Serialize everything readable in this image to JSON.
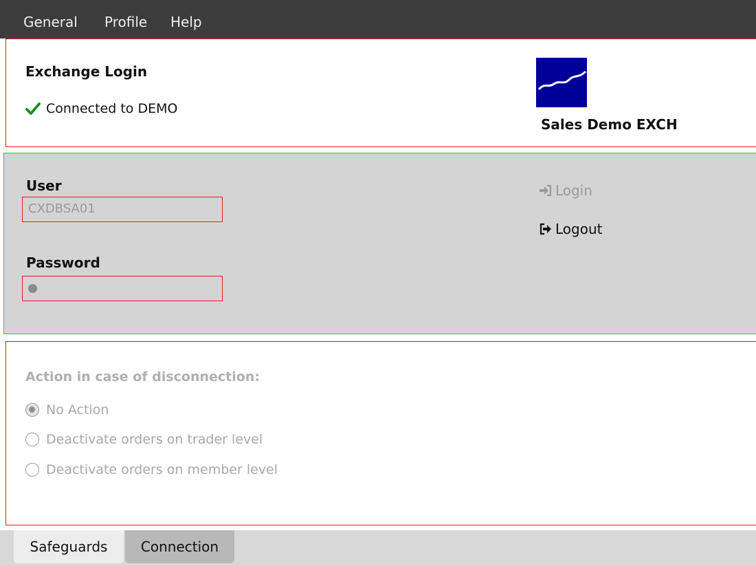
{
  "menu": {
    "items": [
      "General",
      "Profile",
      "Help"
    ]
  },
  "header": {
    "title": "Exchange Login",
    "status": "Connected to DEMO",
    "status_icon": "checkmark-icon",
    "status_color": "#1e8f1e",
    "exchange_name": "Sales Demo EXCH",
    "logo_color": "#000099"
  },
  "login": {
    "user_label": "User",
    "user_value": "CXDBSA01",
    "password_label": "Password",
    "login_label": "Login",
    "logout_label": "Logout"
  },
  "disconnection": {
    "title": "Action in case of disconnection:",
    "options": [
      {
        "label": "No Action",
        "checked": true
      },
      {
        "label": "Deactivate orders on trader level",
        "checked": false
      },
      {
        "label": "Deactivate orders on member level",
        "checked": false
      }
    ]
  },
  "tabs": [
    {
      "label": "Safeguards",
      "active": true
    },
    {
      "label": "Connection",
      "active": false
    }
  ]
}
